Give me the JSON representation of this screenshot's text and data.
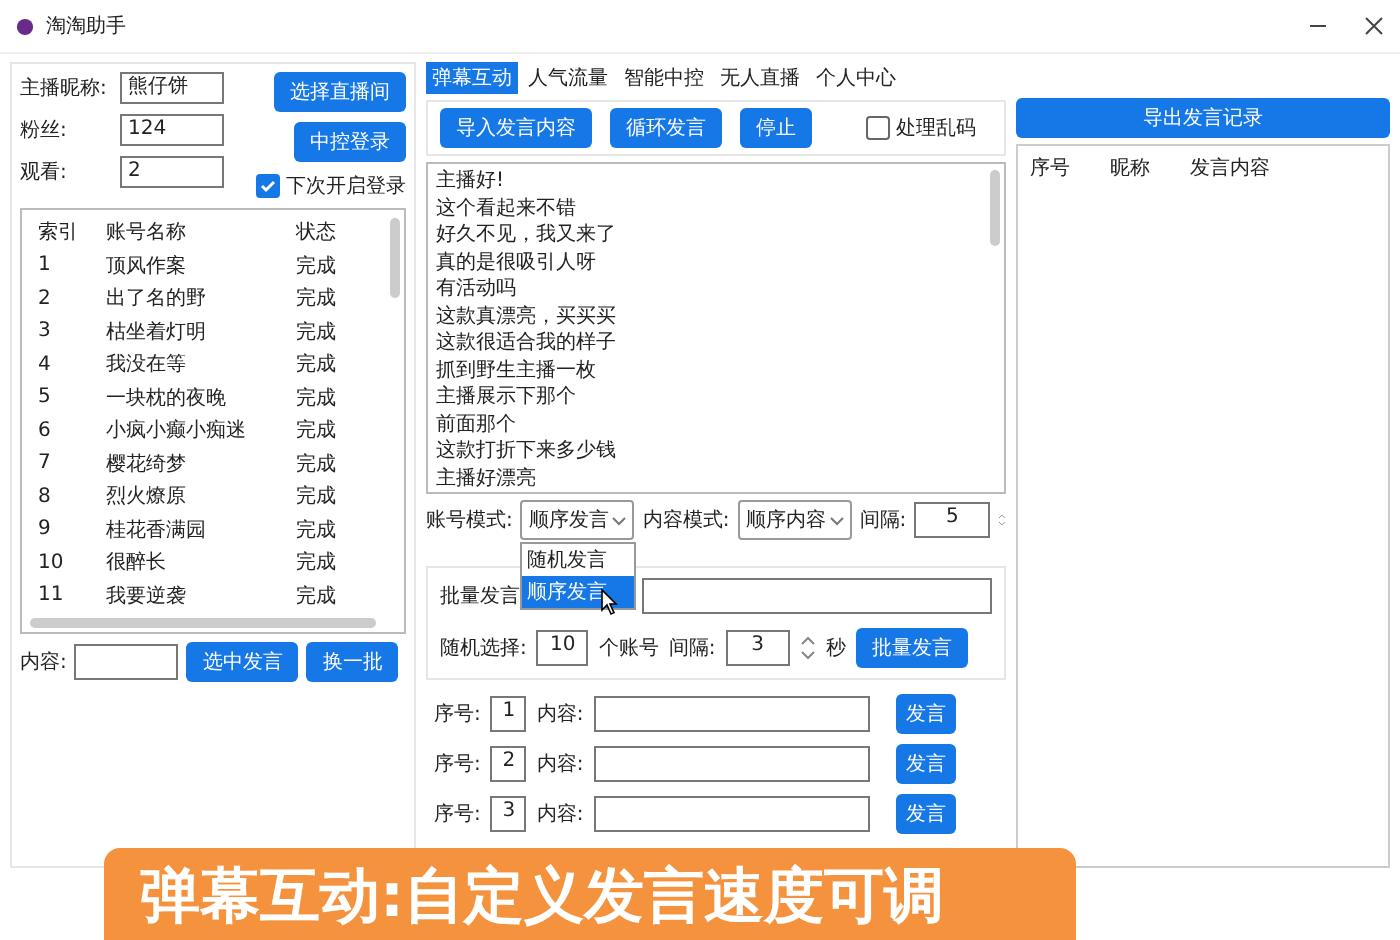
{
  "window": {
    "title": "淘淘助手"
  },
  "left": {
    "fields": [
      {
        "label": "主播昵称:",
        "value": "熊仔饼"
      },
      {
        "label": "粉丝:",
        "value": "124"
      },
      {
        "label": "观看:",
        "value": "2"
      }
    ],
    "buttons": [
      "选择直播间",
      "中控登录"
    ],
    "auto_login": {
      "label": "下次开启登录",
      "checked": true
    },
    "table": {
      "columns": [
        "索引",
        "账号名称",
        "状态"
      ],
      "rows": [
        [
          "1",
          "顶风作案",
          "完成"
        ],
        [
          "2",
          "出了名的野",
          "完成"
        ],
        [
          "3",
          "枯坐着灯明",
          "完成"
        ],
        [
          "4",
          "我没在等",
          "完成"
        ],
        [
          "5",
          "一块枕的夜晚",
          "完成"
        ],
        [
          "6",
          "小疯小癫小痴迷",
          "完成"
        ],
        [
          "7",
          "樱花绮梦",
          "完成"
        ],
        [
          "8",
          "烈火燎原",
          "完成"
        ],
        [
          "9",
          "桂花香满园",
          "完成"
        ],
        [
          "10",
          "很醉长",
          "完成"
        ],
        [
          "11",
          "我要逆袭",
          "完成"
        ]
      ]
    },
    "content": {
      "label": "内容:"
    },
    "actions": [
      "选中发言",
      "换一批"
    ]
  },
  "tabs": [
    {
      "label": "弹幕互动",
      "selected": true
    },
    {
      "label": "人气流量",
      "selected": false
    },
    {
      "label": "智能中控",
      "selected": false
    },
    {
      "label": "无人直播",
      "selected": false
    },
    {
      "label": "个人中心",
      "selected": false
    }
  ],
  "toolbar": {
    "buttons": [
      "导入发言内容",
      "循环发言",
      "停止"
    ],
    "garble": {
      "label": "处理乱码",
      "checked": false
    }
  },
  "messages": [
    "主播好!",
    "这个看起来不错",
    "好久不见，我又来了",
    "真的是很吸引人呀",
    "有活动吗",
    "这款真漂亮，买买买",
    "这款很适合我的样子",
    "抓到野生主播一枚",
    "主播展示下那个",
    "前面那个",
    "这款打折下来多少钱",
    "主播好漂亮"
  ],
  "modes": {
    "account_label": "账号模式:",
    "account_value": "顺序发言",
    "content_label": "内容模式:",
    "content_value": "顺序内容",
    "interval_label": "间隔:",
    "interval_value": "5"
  },
  "dropdown": [
    {
      "label": "随机发言",
      "selected": false
    },
    {
      "label": "顺序发言",
      "selected": true
    }
  ],
  "batch": {
    "label": "批量发言",
    "random_label": "随机选择:",
    "random_value": "10",
    "unit": "个账号",
    "interval_label": "间隔:",
    "interval_value": "3",
    "seconds": "秒",
    "button": "批量发言"
  },
  "send_rows": [
    {
      "index_label": "序号:",
      "index": "1",
      "content_label": "内容:",
      "button": "发言"
    },
    {
      "index_label": "序号:",
      "index": "2",
      "content_label": "内容:",
      "button": "发言"
    },
    {
      "index_label": "序号:",
      "index": "3",
      "content_label": "内容:",
      "button": "发言"
    }
  ],
  "right": {
    "export_button": "导出发言记录",
    "columns": [
      "序号",
      "昵称",
      "发言内容"
    ]
  },
  "caption": "弹幕互动:自定义发言速度可调"
}
